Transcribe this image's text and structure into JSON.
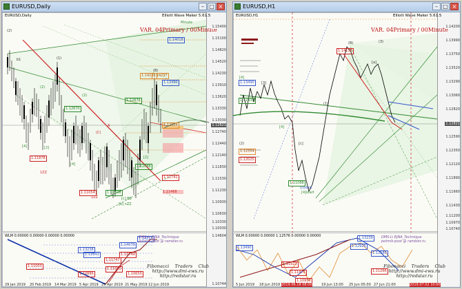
{
  "left_window": {
    "title": "EURUSD,Daily",
    "symbol": "EURUSD,Daily",
    "indicator": "Elliott Wave Maker 5.61.5",
    "variant": "VAR. 04Primary / 00Minute",
    "wave_labels": [
      "(2)",
      "Minute",
      "(1)",
      "(B)",
      "A",
      "(C)",
      "[c] EB",
      "[b] nZZ",
      "(2)",
      "(2)",
      "[4]",
      "[4]",
      "[2]",
      "[2]",
      "1ZZ",
      "1ZZ",
      "b1"
    ],
    "level_labels": [
      "1.14231",
      "1.14297",
      "1.14018",
      "1.13490",
      "1.12876",
      "1.12670",
      "1.12354",
      "1.12088",
      "1.11878",
      "1.11741",
      "1.11468",
      "1.11054",
      "1.10838"
    ],
    "price_axis": [
      "1.15400",
      "1.15100",
      "1.14820",
      "1.14520",
      "1.14230",
      "1.13910",
      "1.13620",
      "1.13330",
      "1.13030",
      "1.12740",
      "1.12440",
      "1.12140",
      "1.11830",
      "1.11530",
      "1.11230",
      "1.10930",
      "1.10630",
      "1.10330",
      "1.10030"
    ],
    "current_price": "1.12821",
    "osc_label": "WLM 0.00000 0.00000 0.00000 0.00000",
    "osc_prices": [
      "1.14604",
      "1.10744"
    ],
    "osc_levels": [
      "1.14218",
      "1.14079",
      "1.13238",
      "1.12643",
      "1.12749",
      "1.11747",
      "1.11050",
      "1.11003",
      "1.10886",
      "1.10650"
    ],
    "watermark_top": "DMS-Li EJNA_Technique\npotmik-post @ rambler.ru",
    "watermark_bottom": "Fibonacci    Traders    Club\nhttp://www.dmi-ews.ru\nhttp://redstar.ru",
    "dates": [
      "29 Jan 2019",
      "20 Feb 2019",
      "14 Mar 2019",
      "5 Apr 2019",
      "29 Apr 2019",
      "21 May 2019",
      "12 Jun 2019"
    ]
  },
  "right_window": {
    "title": "EURUSD,H1",
    "symbol": "EURUSD,H1",
    "indicator": "Elliott Wave Maker 5.61.5",
    "variant": "VAR. 04Primary / 00Minute",
    "wave_labels": [
      "(B)",
      "[3]",
      "[a]",
      "[4]",
      "[4]",
      "[c]",
      "(1)",
      "(2)",
      "(3)",
      "(i)Start",
      "[4]start"
    ],
    "level_labels": [
      "1.14158",
      "1.13490",
      "1.12930",
      "1.12354",
      "1.11088",
      "1.12025"
    ],
    "price_axis": [
      "1.14200",
      "1.13990",
      "1.13750",
      "1.13520",
      "1.13290",
      "1.13060",
      "1.12820",
      "1.12590",
      "1.12350",
      "1.12120",
      "1.11890",
      "1.11660",
      "1.11430",
      "1.11200",
      "1.10970",
      "1.10740"
    ],
    "current_price": "1.12821",
    "osc_label": "WLM 0.00000 0.00000 1.12576 0.00000 0.00000",
    "osc_levels": [
      "1.13490",
      "1.13239",
      "1.12926",
      "1.12580",
      "1.11923",
      "1.11476",
      "1.11266",
      "1.10950"
    ],
    "watermark_top": "DMS-Li EJNA_Technique\npotmik-post @ rambler.ru",
    "watermark_bottom": "Fibonacci    Traders    Club\nhttp://www.dmi-ews.ru\nhttp://redstar.ru",
    "dates": [
      "5 Jun 2019",
      "18 Jun 2019",
      "2019.06.18 08:00",
      "19 Jun 13:00",
      "25 Jun 05:00",
      "27 Jun 21:00",
      "2019.07.02 10:00"
    ]
  },
  "colors": {
    "accent_red": "#cc2222",
    "trend_green": "#2f8a2f",
    "osc_blue": "#0b2fa8",
    "fib_orange": "#e08a2e"
  }
}
